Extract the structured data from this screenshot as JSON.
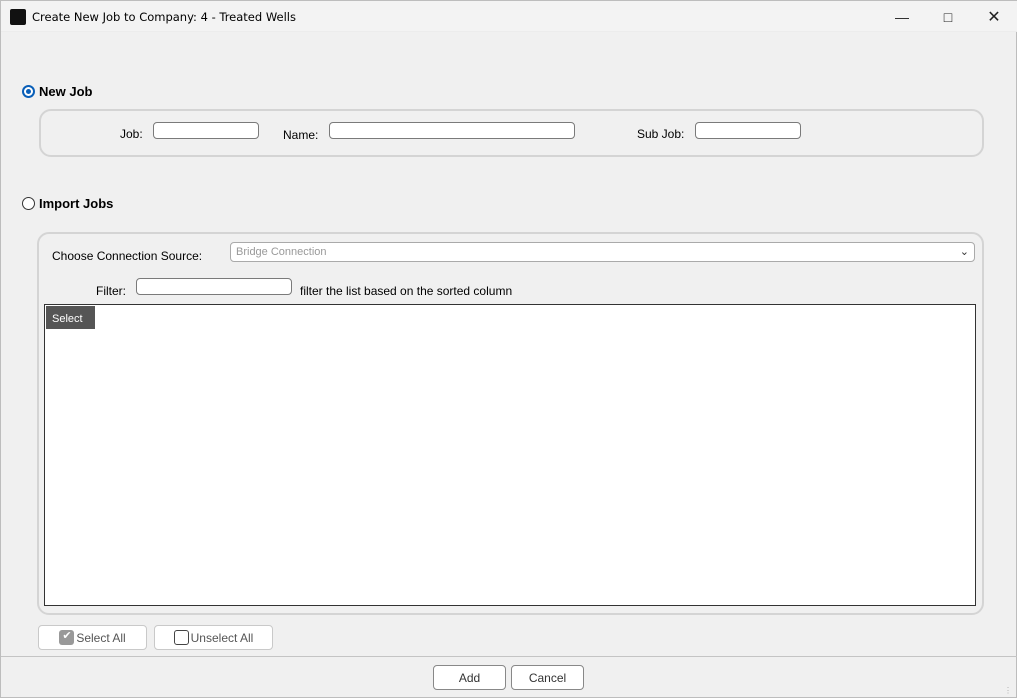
{
  "window": {
    "title": "Create New Job to Company: 4 - Treated Wells"
  },
  "new_job": {
    "label": "New Job",
    "selected": true,
    "job_label": "Job:",
    "job_value": "",
    "name_label": "Name:",
    "name_value": "",
    "subjob_label": "Sub Job:",
    "subjob_value": ""
  },
  "import_jobs": {
    "label": "Import Jobs",
    "selected": false,
    "source_label": "Choose Connection Source:",
    "source_value": "Bridge Connection",
    "filter_label": "Filter:",
    "filter_value": "",
    "filter_hint": "filter the list based on the sorted column",
    "columns": [
      "Select"
    ],
    "rows": []
  },
  "buttons": {
    "select_all": "Select All",
    "unselect_all": "Unselect All",
    "add": "Add",
    "cancel": "Cancel"
  },
  "colors": {
    "accent": "#0a5fb8",
    "header": "#555555"
  }
}
